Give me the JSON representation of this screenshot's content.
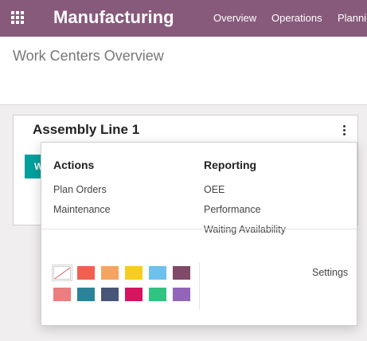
{
  "navbar": {
    "app_title": "Manufacturing",
    "menu": [
      "Overview",
      "Operations",
      "Planni"
    ],
    "background": "#875a7b"
  },
  "breadcrumb": "Work Centers Overview",
  "card": {
    "title": "Assembly Line 1",
    "button_label": "W",
    "button_color": "#00a09d"
  },
  "dropdown": {
    "actions_title": "Actions",
    "actions": [
      "Plan Orders",
      "Maintenance"
    ],
    "reporting_title": "Reporting",
    "reporting": [
      "OEE",
      "Performance",
      "Waiting Availability"
    ],
    "settings_label": "Settings",
    "colors": [
      "none",
      "#f06050",
      "#f4a460",
      "#f7cd1f",
      "#6cc1ed",
      "#814968",
      "#eb7e7f",
      "#2c8397",
      "#475577",
      "#d6145f",
      "#30c381",
      "#9365b8"
    ]
  }
}
